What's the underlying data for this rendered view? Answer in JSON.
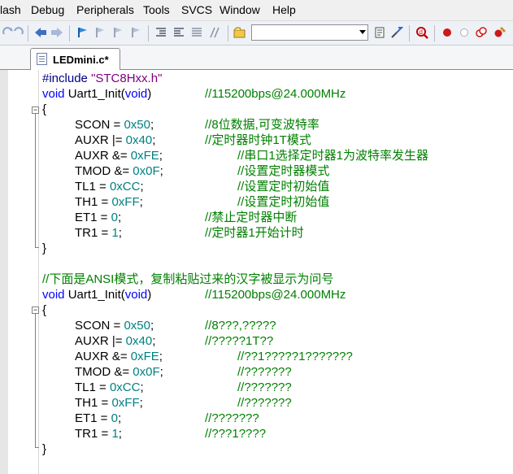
{
  "menu": {
    "items": [
      "lash",
      "Debug",
      "Peripherals",
      "Tools",
      "SVCS",
      "Window",
      "Help"
    ]
  },
  "toolbar": {
    "icons": [
      "redo-icon",
      "back-icon",
      "forward-icon",
      "bookmark-icon",
      "prev-bookmark-icon",
      "next-bookmark-icon",
      "clear-bookmarks-icon",
      "indent-icon",
      "unindent-icon",
      "comment-icon",
      "uncomment-icon",
      "find-in-files-icon",
      "target-settings-icon",
      "debug-icon",
      "breakpoint-icon",
      "disable-breakpoint-icon",
      "kill-breakpoints-icon"
    ],
    "combo_value": ""
  },
  "tab": {
    "label": "LEDmini.c*"
  },
  "code": {
    "include": {
      "directive": "#include",
      "file": "\"STC8Hxx.h\""
    },
    "func1": {
      "kw_void": "void",
      "name": "Uart1_Init(",
      "param": "void",
      "close": ")",
      "comment": "//115200bps@24.000MHz"
    },
    "block1": [
      {
        "lhs": "SCON = ",
        "num": "0x50",
        "end": ";",
        "comment": "//8位数据,可变波特率"
      },
      {
        "lhs": "AUXR |= ",
        "num": "0x40",
        "end": ";",
        "comment": "//定时器时钟1T模式"
      },
      {
        "lhs": "AUXR &= ",
        "num": "0xFE",
        "end": ";",
        "comment": "//串口1选择定时器1为波特率发生器"
      },
      {
        "lhs": "TMOD &= ",
        "num": "0x0F",
        "end": ";",
        "comment": "//设置定时器模式"
      },
      {
        "lhs": "TL1 = ",
        "num": "0xCC",
        "end": ";",
        "comment": "//设置定时初始值"
      },
      {
        "lhs": "TH1 = ",
        "num": "0xFF",
        "end": ";",
        "comment": "//设置定时初始值"
      },
      {
        "lhs": "ET1 = ",
        "num": "0",
        "end": ";",
        "comment": "//禁止定时器中断"
      },
      {
        "lhs": "TR1 = ",
        "num": "1",
        "end": ";",
        "comment": "//定时器1开始计时"
      }
    ],
    "note": "//下面是ANSI模式，复制粘贴过来的汉字被显示为问号",
    "func2": {
      "kw_void": "void",
      "name": "Uart1_Init(",
      "param": "void",
      "close": ")",
      "comment": "//115200bps@24.000MHz"
    },
    "block2": [
      {
        "lhs": "SCON = ",
        "num": "0x50",
        "end": ";",
        "comment": "//8???,?????"
      },
      {
        "lhs": "AUXR |= ",
        "num": "0x40",
        "end": ";",
        "comment": "//?????1T??"
      },
      {
        "lhs": "AUXR &= ",
        "num": "0xFE",
        "end": ";",
        "comment": "//??1?????1???????"
      },
      {
        "lhs": "TMOD &= ",
        "num": "0x0F",
        "end": ";",
        "comment": "//???????"
      },
      {
        "lhs": "TL1 = ",
        "num": "0xCC",
        "end": ";",
        "comment": "//???????"
      },
      {
        "lhs": "TH1 = ",
        "num": "0xFF",
        "end": ";",
        "comment": "//???????"
      },
      {
        "lhs": "ET1 = ",
        "num": "0",
        "end": ";",
        "comment": "//???????"
      },
      {
        "lhs": "TR1 = ",
        "num": "1",
        "end": ";",
        "comment": "//???1????"
      }
    ],
    "open_brace": "{",
    "close_brace": "}"
  }
}
